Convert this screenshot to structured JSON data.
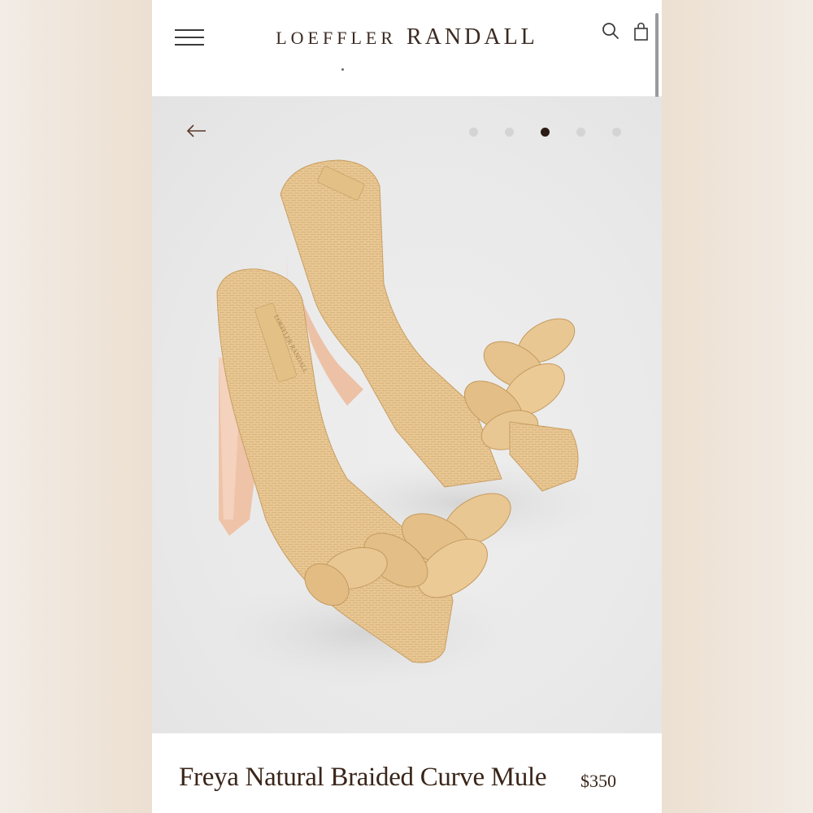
{
  "brand": {
    "name_part1": "LOEFFLER",
    "name_part2": "RANDALL"
  },
  "header": {
    "menu_icon": "hamburger-menu-icon",
    "search_icon": "search-icon",
    "bag_icon": "shopping-bag-icon"
  },
  "gallery": {
    "back_icon": "arrow-left-icon",
    "total_images": 5,
    "active_index": 2,
    "image_subject": "braided-raffia-mule-sandals"
  },
  "product": {
    "name": "Freya Natural Braided Curve Mule",
    "price": "$350"
  },
  "colors": {
    "brand_text": "#3b2a22",
    "active_dot": "#2a1c14",
    "inactive_dot": "#d4d4d4",
    "raffia": "#e8c48f"
  }
}
